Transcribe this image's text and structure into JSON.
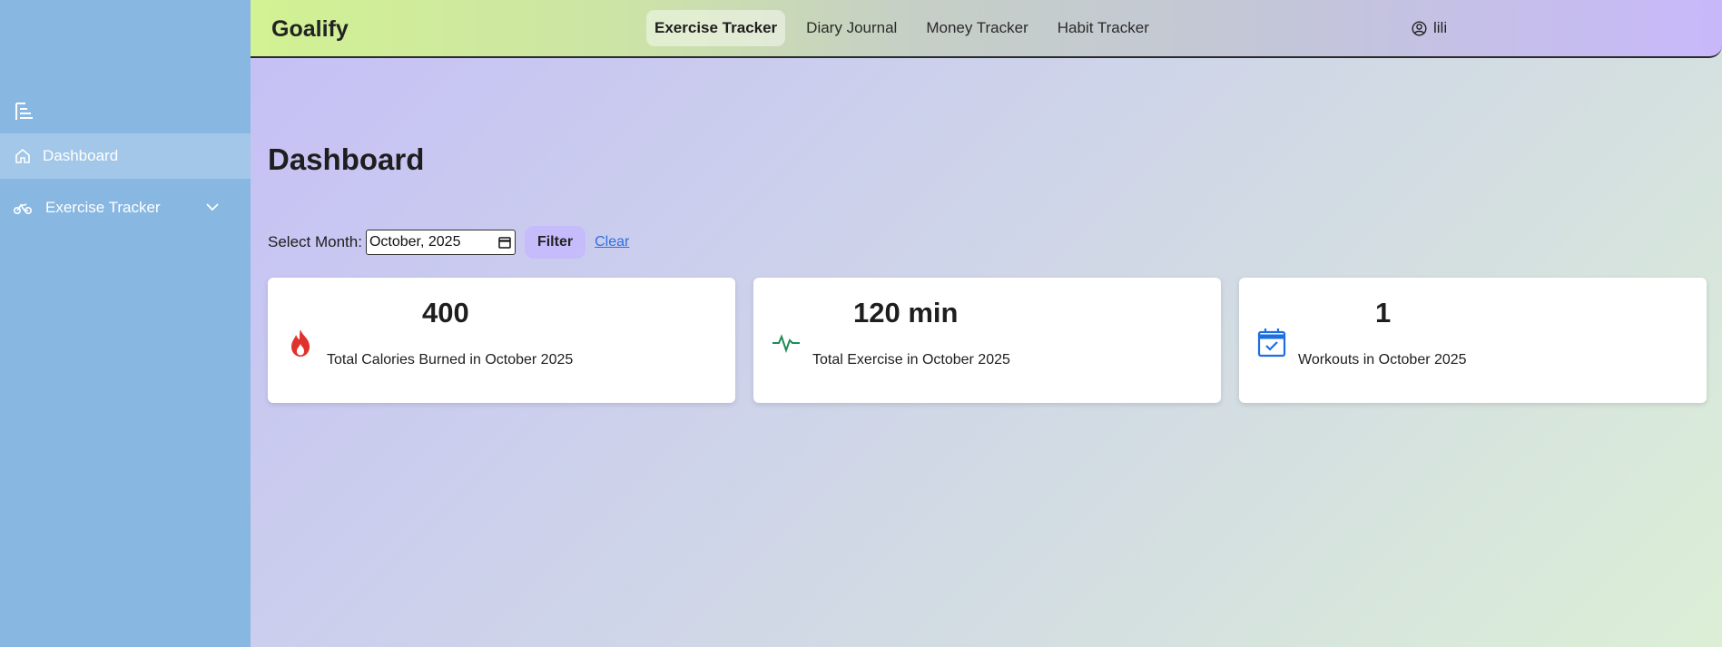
{
  "app": {
    "brand": "Goalify"
  },
  "nav": {
    "items": [
      {
        "label": "Exercise Tracker",
        "active": true
      },
      {
        "label": "Diary Journal",
        "active": false
      },
      {
        "label": "Money Tracker",
        "active": false
      },
      {
        "label": "Habit Tracker",
        "active": false
      }
    ]
  },
  "user": {
    "name": "lili",
    "icon": "user-circle-icon"
  },
  "sidebar": {
    "toggle_icon": "sidebar-toggle-icon",
    "items": [
      {
        "label": "Dashboard",
        "icon": "home-icon",
        "active": true
      },
      {
        "label": "Exercise Tracker",
        "icon": "bike-icon",
        "active": false,
        "expandable": true
      }
    ]
  },
  "main": {
    "title": "Dashboard",
    "filter": {
      "label": "Select Month:",
      "value": "October, 2025",
      "filter_label": "Filter",
      "clear_label": "Clear"
    },
    "cards": [
      {
        "value": "400",
        "label": "Total Calories Burned in October 2025",
        "icon": "fire-icon",
        "color": "#e0322d"
      },
      {
        "value": "120 min",
        "label": "Total Exercise in October 2025",
        "icon": "pulse-icon",
        "color": "#1e8a5a"
      },
      {
        "value": "1",
        "label": "Workouts in October 2025",
        "icon": "calendar-check-icon",
        "color": "#1d6fe0"
      }
    ]
  },
  "colors": {
    "sidebar_bg": "#88b8e2",
    "filter_button": "#c6bbfb",
    "link": "#2d6fe0"
  }
}
